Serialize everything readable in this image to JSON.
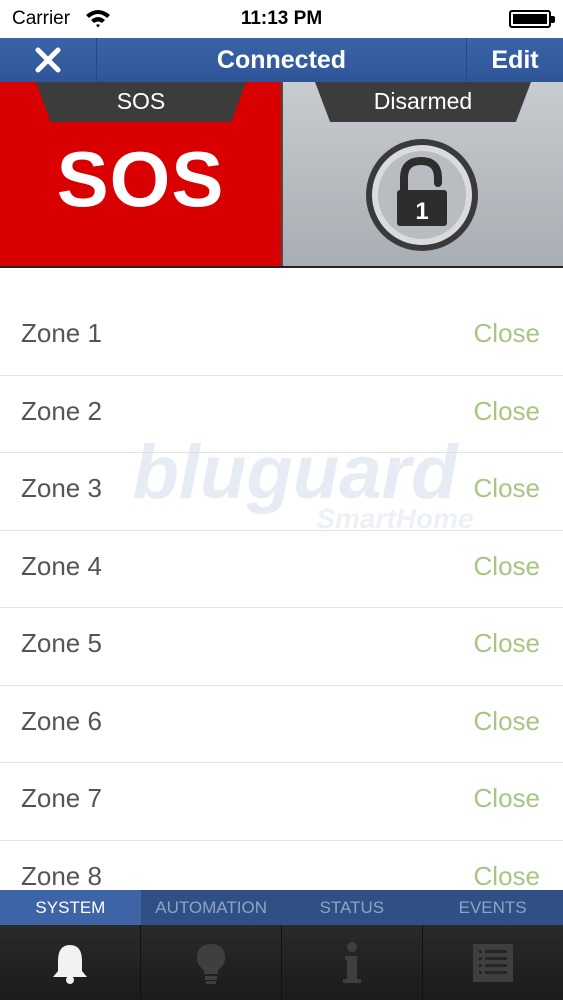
{
  "status_bar": {
    "carrier": "Carrier",
    "time": "11:13 PM"
  },
  "nav": {
    "title": "Connected",
    "edit_label": "Edit",
    "close_icon": "close-icon"
  },
  "panels": {
    "sos": {
      "tab_label": "SOS",
      "big_text": "SOS",
      "color": "#d80000"
    },
    "disarmed": {
      "tab_label": "Disarmed",
      "lock_number": "1",
      "icon": "unlocked-padlock-icon"
    }
  },
  "zones": [
    {
      "name": "Zone 1",
      "state": "Close"
    },
    {
      "name": "Zone 2",
      "state": "Close"
    },
    {
      "name": "Zone 3",
      "state": "Close"
    },
    {
      "name": "Zone 4",
      "state": "Close"
    },
    {
      "name": "Zone 5",
      "state": "Close"
    },
    {
      "name": "Zone 6",
      "state": "Close"
    },
    {
      "name": "Zone 7",
      "state": "Close"
    },
    {
      "name": "Zone 8",
      "state": "Close"
    }
  ],
  "watermark": {
    "brand": "bluguard",
    "sub": "SmartHome"
  },
  "tabs": [
    {
      "label": "SYSTEM",
      "icon": "bell-icon",
      "active": true
    },
    {
      "label": "AUTOMATION",
      "icon": "lightbulb-icon",
      "active": false
    },
    {
      "label": "STATUS",
      "icon": "info-icon",
      "active": false
    },
    {
      "label": "EVENTS",
      "icon": "event-list-icon",
      "active": false
    }
  ],
  "colors": {
    "nav": "#3a64a8",
    "zone_state": "#a9c583",
    "sos_red": "#d80000"
  }
}
